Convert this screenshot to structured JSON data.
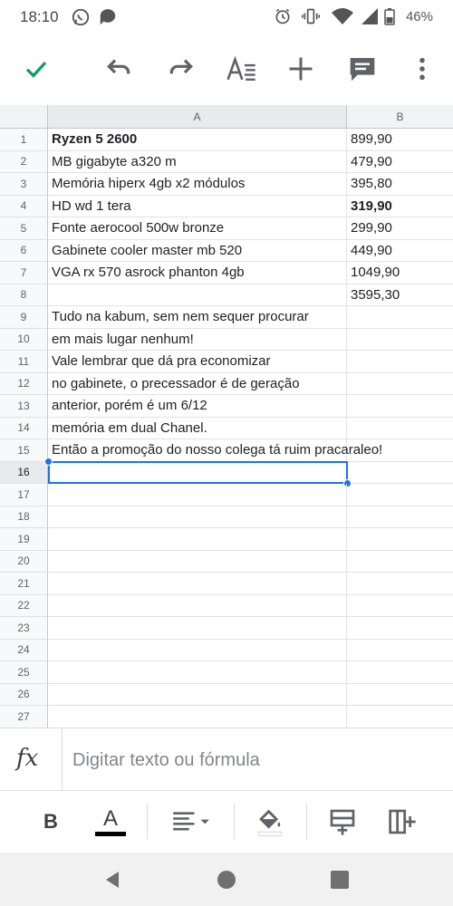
{
  "status_bar": {
    "time": "18:10",
    "battery": "46%"
  },
  "sheet": {
    "columns": [
      "A",
      "B"
    ],
    "rows": [
      {
        "num": "1",
        "a": "Ryzen 5 2600",
        "b": "899,90",
        "a_bold": true,
        "b_bold": false
      },
      {
        "num": "2",
        "a": "MB gigabyte a320 m",
        "b": "479,90",
        "a_bold": false,
        "b_bold": false
      },
      {
        "num": "3",
        "a": "Memória hiperx 4gb x2 módulos",
        "b": "395,80",
        "a_bold": false,
        "b_bold": false
      },
      {
        "num": "4",
        "a": "HD wd 1 tera",
        "b": "319,90",
        "a_bold": false,
        "b_bold": true
      },
      {
        "num": "5",
        "a": "Fonte aerocool 500w bronze",
        "b": "299,90",
        "a_bold": false,
        "b_bold": false
      },
      {
        "num": "6",
        "a": "Gabinete cooler master mb 520",
        "b": "449,90",
        "a_bold": false,
        "b_bold": false
      },
      {
        "num": "7",
        "a": "VGA rx 570 asrock phanton 4gb",
        "b": "1049,90",
        "a_bold": false,
        "b_bold": false
      },
      {
        "num": "8",
        "a": "",
        "b": "3595,30",
        "a_bold": false,
        "b_bold": false
      },
      {
        "num": "9",
        "a": "Tudo na kabum, sem nem sequer procurar",
        "b": "",
        "a_bold": false,
        "b_bold": false
      },
      {
        "num": "10",
        "a": "em mais lugar nenhum!",
        "b": "",
        "a_bold": false,
        "b_bold": false
      },
      {
        "num": "11",
        "a": "Vale lembrar que dá pra economizar",
        "b": "",
        "a_bold": false,
        "b_bold": false
      },
      {
        "num": "12",
        "a": "no gabinete, o precessador é de geração",
        "b": "",
        "a_bold": false,
        "b_bold": false
      },
      {
        "num": "13",
        "a": "anterior, porém é um 6/12",
        "b": "",
        "a_bold": false,
        "b_bold": false
      },
      {
        "num": "14",
        "a": "memória em dual Chanel.",
        "b": "",
        "a_bold": false,
        "b_bold": false
      },
      {
        "num": "15",
        "a": "Então a promoção do nosso colega tá ruim pracaraleo!",
        "b": "",
        "a_bold": false,
        "b_bold": false
      },
      {
        "num": "16",
        "a": "",
        "b": "",
        "a_bold": false,
        "b_bold": false
      },
      {
        "num": "17",
        "a": "",
        "b": "",
        "a_bold": false,
        "b_bold": false
      },
      {
        "num": "18",
        "a": "",
        "b": "",
        "a_bold": false,
        "b_bold": false
      },
      {
        "num": "19",
        "a": "",
        "b": "",
        "a_bold": false,
        "b_bold": false
      },
      {
        "num": "20",
        "a": "",
        "b": "",
        "a_bold": false,
        "b_bold": false
      },
      {
        "num": "21",
        "a": "",
        "b": "",
        "a_bold": false,
        "b_bold": false
      },
      {
        "num": "22",
        "a": "",
        "b": "",
        "a_bold": false,
        "b_bold": false
      },
      {
        "num": "23",
        "a": "",
        "b": "",
        "a_bold": false,
        "b_bold": false
      },
      {
        "num": "24",
        "a": "",
        "b": "",
        "a_bold": false,
        "b_bold": false
      },
      {
        "num": "25",
        "a": "",
        "b": "",
        "a_bold": false,
        "b_bold": false
      },
      {
        "num": "26",
        "a": "",
        "b": "",
        "a_bold": false,
        "b_bold": false
      },
      {
        "num": "27",
        "a": "",
        "b": "",
        "a_bold": false,
        "b_bold": false
      }
    ],
    "selected_row": "16"
  },
  "formula_bar": {
    "fx_label": "fx",
    "placeholder": "Digitar texto ou fórmula"
  },
  "format_bar": {
    "bold_label": "B",
    "text_color_label": "A"
  },
  "icons": {
    "toolbar": [
      "check-icon",
      "undo-icon",
      "redo-icon",
      "text-format-icon",
      "add-icon",
      "comment-icon",
      "more-icon"
    ],
    "format_bar": [
      "bold-icon",
      "text-color-icon",
      "align-icon",
      "fill-color-icon",
      "insert-row-icon",
      "insert-column-icon"
    ],
    "nav": [
      "back-icon",
      "home-icon",
      "recents-icon"
    ]
  },
  "colors": {
    "accent_green": "#0f9d58",
    "selection_blue": "#1a73e8"
  }
}
